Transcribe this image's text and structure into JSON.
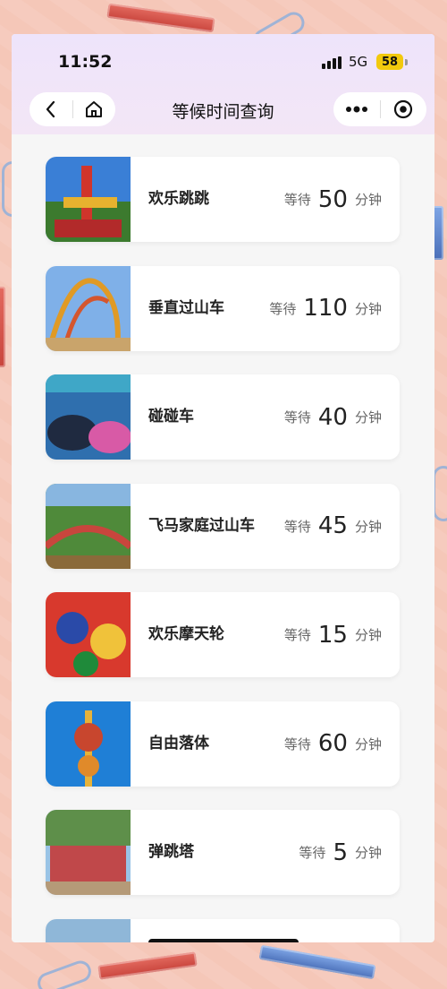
{
  "status": {
    "time": "11:52",
    "network": "5G",
    "battery": "58"
  },
  "nav": {
    "title": "等候时间查询"
  },
  "rides": [
    {
      "name": "欢乐跳跳",
      "wait_label": "等待",
      "minutes": "50",
      "unit": "分钟"
    },
    {
      "name": "垂直过山车",
      "wait_label": "等待",
      "minutes": "110",
      "unit": "分钟"
    },
    {
      "name": "碰碰车",
      "wait_label": "等待",
      "minutes": "40",
      "unit": "分钟"
    },
    {
      "name": "飞马家庭过山车",
      "wait_label": "等待",
      "minutes": "45",
      "unit": "分钟"
    },
    {
      "name": "欢乐摩天轮",
      "wait_label": "等待",
      "minutes": "15",
      "unit": "分钟"
    },
    {
      "name": "自由落体",
      "wait_label": "等待",
      "minutes": "60",
      "unit": "分钟"
    },
    {
      "name": "弹跳塔",
      "wait_label": "等待",
      "minutes": "5",
      "unit": "分钟"
    }
  ],
  "colors": {
    "battery": "#f2c90d",
    "title_gradient_top": "#eee4fb",
    "background": "#f5c7b8"
  }
}
